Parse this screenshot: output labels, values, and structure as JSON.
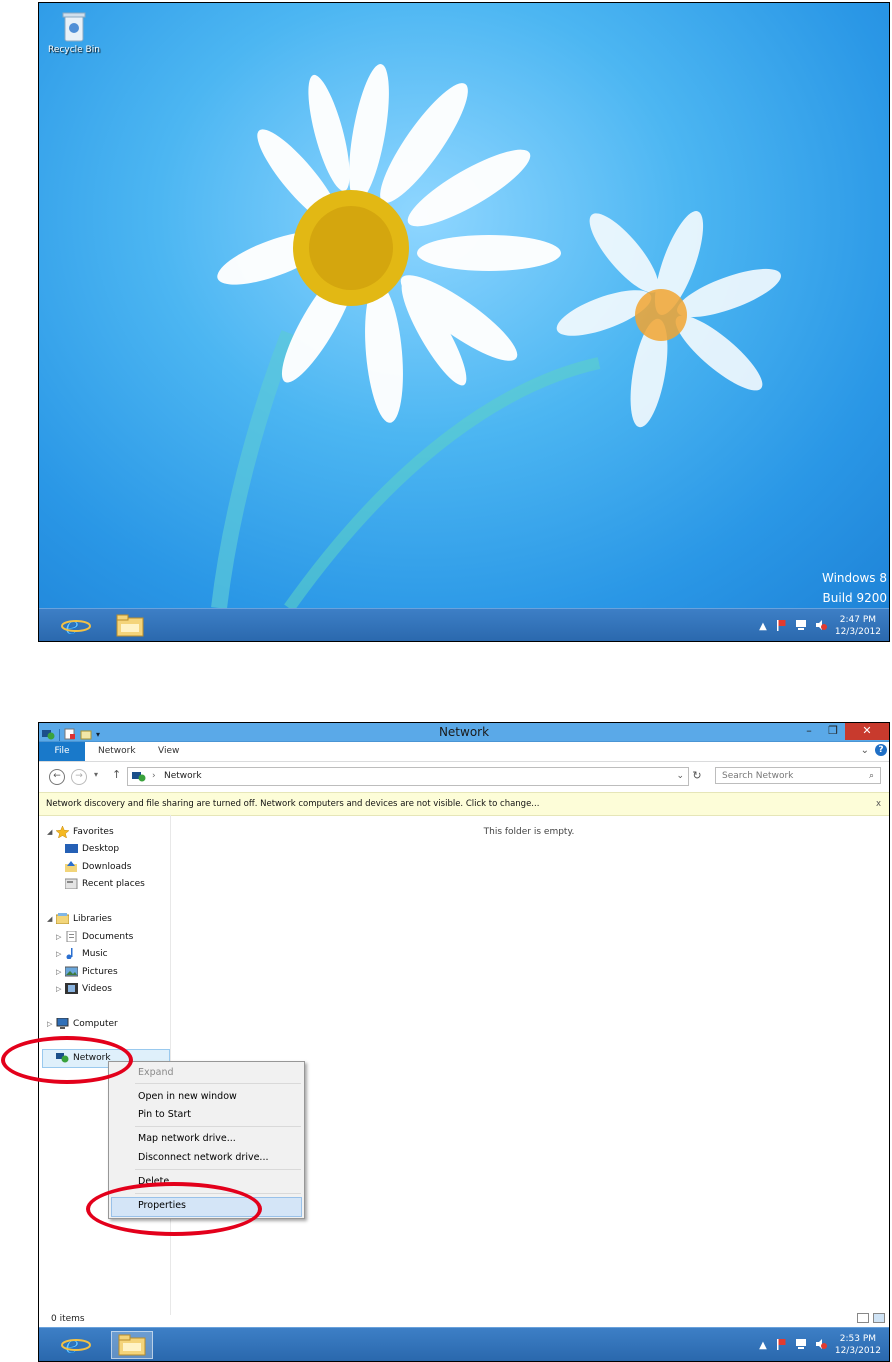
{
  "desktop": {
    "recycle_bin_label": "Recycle Bin",
    "watermark_line1": "Windows 8",
    "watermark_line2": "Build 9200",
    "clock_time": "2:47 PM",
    "clock_date": "12/3/2012",
    "taskbar_icons": [
      "internet-explorer-icon",
      "file-explorer-icon"
    ],
    "tray_icons": [
      "show-hidden-icons-icon",
      "action-center-flag-icon",
      "network-icon",
      "volume-muted-icon"
    ],
    "tray_expand": "▲"
  },
  "explorer": {
    "window_title": "Network",
    "quick_access_icons": [
      "network-icon",
      "properties-icon",
      "new-folder-icon",
      "customize-qat-icon"
    ],
    "window_buttons": {
      "minimize": "–",
      "restore": "❐",
      "close": "✕"
    },
    "ribbon_tabs": {
      "file": "File",
      "network": "Network",
      "view": "View"
    },
    "ribbon_right": {
      "expand": "⌄",
      "help": "?"
    },
    "address": {
      "separator": "›",
      "location": "Network",
      "dropdown": "⌄"
    },
    "nav_buttons": {
      "back": "←",
      "forward": "→",
      "recent": "▾",
      "up": "↑",
      "refresh": "↻"
    },
    "search_placeholder": "Search Network",
    "search_icon_glyph": "⌕",
    "infobar": {
      "message": "Network discovery and file sharing are turned off. Network computers and devices are not visible. Click to change...",
      "close": "x"
    },
    "nav_pane": {
      "favorites": "Favorites",
      "desktop": "Desktop",
      "downloads": "Downloads",
      "recent_places": "Recent places",
      "libraries": "Libraries",
      "documents": "Documents",
      "music": "Music",
      "pictures": "Pictures",
      "videos": "Videos",
      "computer": "Computer",
      "network": "Network",
      "expanded_arrow": "◢",
      "collapsed_arrow": "▷"
    },
    "empty_message": "This folder is empty.",
    "status_count": "0 items",
    "context_menu": {
      "expand": "Expand",
      "open_new_window": "Open in new window",
      "pin_to_start": "Pin to Start",
      "map_network_drive": "Map network drive...",
      "disconnect_network_drive": "Disconnect network drive...",
      "delete": "Delete",
      "properties": "Properties"
    },
    "clock_time": "2:53 PM",
    "clock_date": "12/3/2012",
    "highlight_color": "#e3001b"
  }
}
